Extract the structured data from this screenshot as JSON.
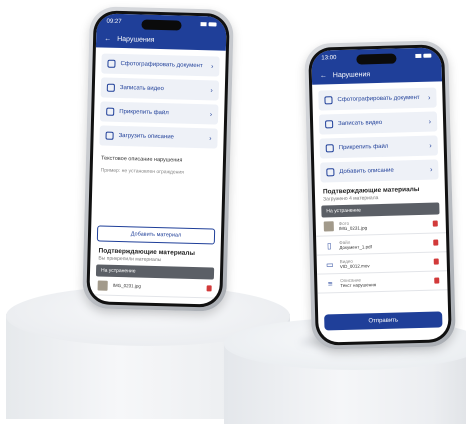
{
  "left_phone": {
    "status_time": "09:27",
    "title": "Нарушения",
    "menu": [
      {
        "label": "Сфотографировать документ",
        "icon": "camera-icon"
      },
      {
        "label": "Записать видео",
        "icon": "video-icon"
      },
      {
        "label": "Прикрепить файл",
        "icon": "file-icon"
      },
      {
        "label": "Загрузить описание",
        "icon": "document-icon"
      }
    ],
    "hint": "Текстовое описание нарушения",
    "placeholder": "Пример: не установлен ограждения",
    "add_button": "Добавить материал",
    "section_title": "Подтверждающие материалы",
    "section_sub": "Вы прикрепили материалы",
    "group_header": "На устранение",
    "row_text": "IMG_0231.jpg"
  },
  "right_phone": {
    "status_time": "13:00",
    "title": "Нарушения",
    "menu": [
      {
        "label": "Сфотографировать документ",
        "icon": "camera-icon"
      },
      {
        "label": "Записать видео",
        "icon": "video-icon"
      },
      {
        "label": "Прикрепить файл",
        "icon": "file-icon"
      },
      {
        "label": "Добавить описание",
        "icon": "document-icon"
      }
    ],
    "section_title": "Подтверждающие материалы",
    "section_sub": "Загружено 4 материала",
    "group_header": "На устранение",
    "materials": [
      {
        "line1": "Фото",
        "line2": "IMG_0231.jpg",
        "kind": "thumb"
      },
      {
        "line1": "Файл",
        "line2": "Документ_1.pdf",
        "kind": "file-icon"
      },
      {
        "line1": "Видео",
        "line2": "VID_0012.mov",
        "kind": "video-icon"
      },
      {
        "line1": "Описание",
        "line2": "Текст нарушения",
        "kind": "text-icon"
      }
    ],
    "submit_button": "Отправить"
  },
  "colors": {
    "primary": "#1f3f99",
    "delete": "#d23a3a",
    "group": "#5b5f66"
  }
}
